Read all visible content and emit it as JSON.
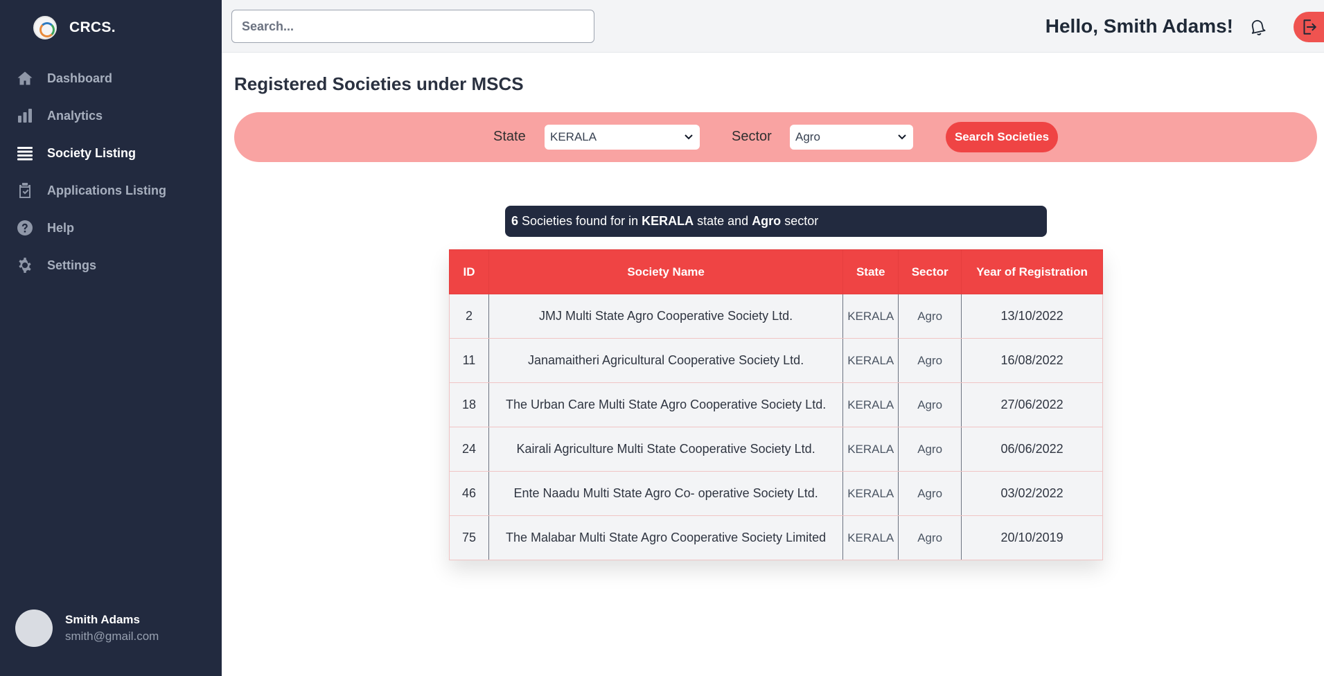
{
  "brand": {
    "name": "CRCS."
  },
  "sidebar": {
    "items": [
      {
        "label": "Dashboard",
        "icon": "home-icon",
        "active": false
      },
      {
        "label": "Analytics",
        "icon": "bar-chart-icon",
        "active": false
      },
      {
        "label": "Society Listing",
        "icon": "list-icon",
        "active": true
      },
      {
        "label": "Applications Listing",
        "icon": "clipboard-icon",
        "active": false
      },
      {
        "label": "Help",
        "icon": "help-icon",
        "active": false
      },
      {
        "label": "Settings",
        "icon": "gear-icon",
        "active": false
      }
    ],
    "user": {
      "name": "Smith Adams",
      "email": "smith@gmail.com"
    }
  },
  "header": {
    "search_placeholder": "Search...",
    "greeting": "Hello, Smith Adams!"
  },
  "main": {
    "title": "Registered Societies under MSCS",
    "filters": {
      "state_label": "State",
      "state_value": "KERALA",
      "sector_label": "Sector",
      "sector_value": "Agro",
      "button_label": "Search Societies"
    },
    "result": {
      "count": "6",
      "text1": " Societies found for in ",
      "state": "KERALA",
      "text2": " state and ",
      "sector": "Agro",
      "text3": " sector"
    },
    "table": {
      "headers": [
        "ID",
        "Society Name",
        "State",
        "Sector",
        "Year of Registration"
      ],
      "rows": [
        [
          "2",
          "JMJ Multi State Agro Cooperative Society Ltd.",
          "KERALA",
          "Agro",
          "13/10/2022"
        ],
        [
          "11",
          "Janamaitheri Agricultural Cooperative Society Ltd.",
          "KERALA",
          "Agro",
          "16/08/2022"
        ],
        [
          "18",
          "The Urban Care Multi State Agro Cooperative Society Ltd.",
          "KERALA",
          "Agro",
          "27/06/2022"
        ],
        [
          "24",
          "Kairali Agriculture Multi State Cooperative Society Ltd.",
          "KERALA",
          "Agro",
          "06/06/2022"
        ],
        [
          "46",
          "Ente Naadu Multi State Agro Co- operative Society Ltd.",
          "KERALA",
          "Agro",
          "03/02/2022"
        ],
        [
          "75",
          "The Malabar Multi State Agro Cooperative Society Limited",
          "KERALA",
          "Agro",
          "20/10/2019"
        ]
      ]
    }
  },
  "colors": {
    "sidebar_bg": "#222a3f",
    "accent_red": "#ef4444",
    "filter_bar_bg": "#f9a3a2",
    "logout_bg": "#ef5350"
  }
}
